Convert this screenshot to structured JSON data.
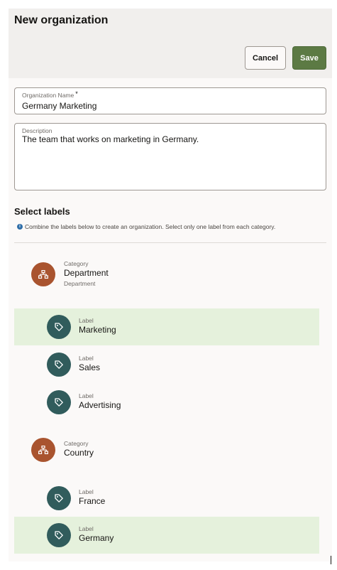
{
  "header": {
    "title": "New organization",
    "cancel_label": "Cancel",
    "save_label": "Save"
  },
  "form": {
    "name_label": "Organization Name",
    "name_required": "*",
    "name_value": "Germany Marketing",
    "description_label": "Description",
    "description_value": "The team that works on marketing in Germany."
  },
  "labels_section": {
    "title": "Select labels",
    "help_icon": "info-icon",
    "help_text": "Combine the labels below to create an organization. Select only one label from each category."
  },
  "categories": [
    {
      "caption": "Category",
      "name": "Department",
      "subtitle": "Department",
      "icon": "hierarchy-icon",
      "labels": [
        {
          "caption": "Label",
          "name": "Marketing",
          "selected": true,
          "icon": "tag-icon"
        },
        {
          "caption": "Label",
          "name": "Sales",
          "selected": false,
          "icon": "tag-icon"
        },
        {
          "caption": "Label",
          "name": "Advertising",
          "selected": false,
          "icon": "tag-icon"
        }
      ]
    },
    {
      "caption": "Category",
      "name": "Country",
      "icon": "hierarchy-icon",
      "labels": [
        {
          "caption": "Label",
          "name": "France",
          "selected": false,
          "icon": "tag-icon"
        },
        {
          "caption": "Label",
          "name": "Germany",
          "selected": true,
          "icon": "tag-icon"
        }
      ]
    }
  ],
  "colors": {
    "category_icon_bg": "#a9542f",
    "label_icon_bg": "#315c5c",
    "selected_row_bg": "#e5f1dc",
    "save_button_bg": "#5c7a44"
  }
}
